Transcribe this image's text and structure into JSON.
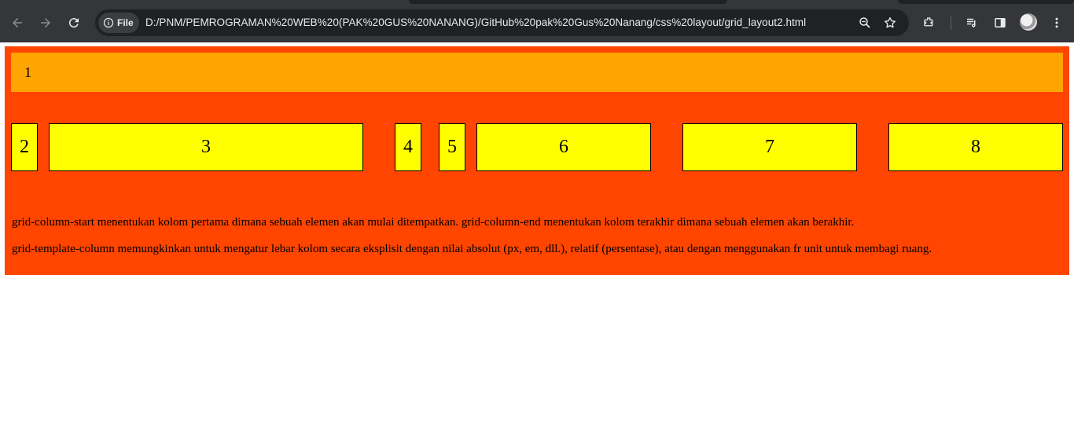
{
  "browser": {
    "url": "D:/PNM/PEMROGRAMAN%20WEB%20(PAK%20GUS%20NANANG)/GitHub%20pak%20Gus%20Nanang/css%20layout/grid_layout2.html",
    "site_chip_label": "File",
    "icons": [
      "back-arrow-icon",
      "forward-arrow-icon",
      "reload-icon",
      "info-icon",
      "zoom-icon",
      "bookmark-star-icon",
      "extensions-icon",
      "media-control-icon",
      "side-panel-icon",
      "profile-avatar",
      "menu-dots-icon"
    ]
  },
  "page": {
    "colors": {
      "container": "#ff4500",
      "item_wide": "#ffa500",
      "item": "#ffff00"
    },
    "grid_items": [
      "1",
      "2",
      "3",
      "4",
      "5",
      "6",
      "7",
      "8"
    ],
    "paragraphs": [
      "grid-column-start menentukan kolom pertama dimana sebuah elemen akan mulai ditempatkan. grid-column-end menentukan kolom terakhir dimana sebuah elemen akan berakhir.",
      "grid-template-column memungkinkan untuk mengatur lebar kolom secara eksplisit dengan nilai absolut (px, em, dll.), relatif (persentase), atau dengan menggunakan fr unit untuk membagi ruang."
    ]
  }
}
